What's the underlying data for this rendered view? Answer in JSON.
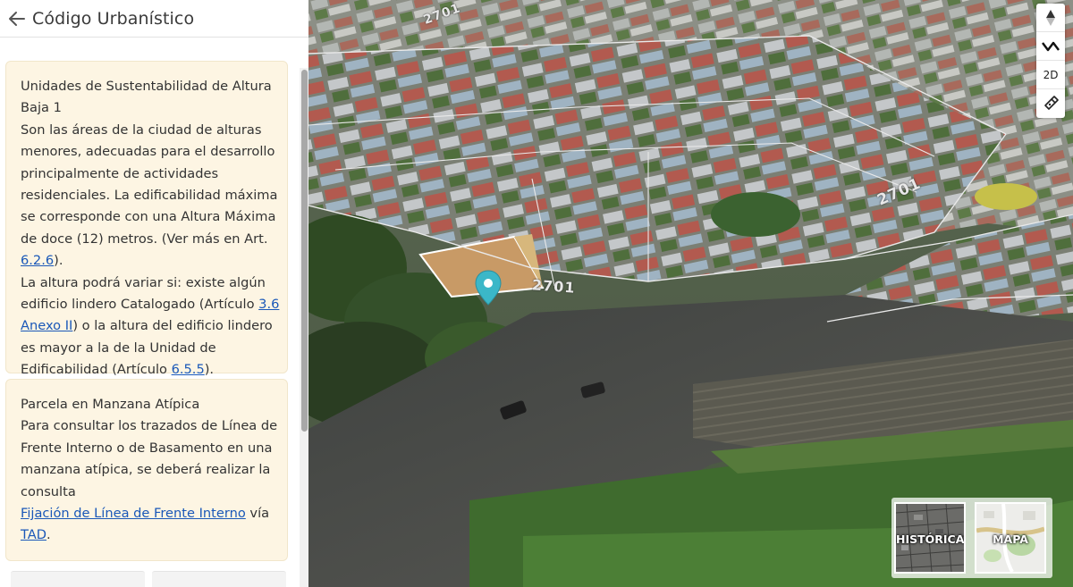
{
  "header": {
    "title": "Código Urbanístico",
    "back_icon": "arrow-left-icon"
  },
  "cards": [
    {
      "title": "Unidades de Sustentabilidad de Altura Baja 1",
      "text_1": "Son las áreas de la ciudad de alturas menores, adecuadas para el desarrollo principalmente de actividades residenciales. La edificabilidad máxima se corresponde con una Altura Máxima de doce (12) metros. (Ver más en Art. ",
      "link_1": "6.2.6",
      "text_2": ").",
      "text_3": "La altura podrá variar si: existe algún edificio lindero Catalogado (Artículo ",
      "link_2": "3.6 Anexo II",
      "text_4": ") o la altura del edificio lindero es mayor a la de la Unidad de Edificabilidad (Artículo ",
      "link_3": "6.5.5",
      "text_5": ")."
    },
    {
      "title": "Parcela en Manzana Atípica",
      "text_1": "Para consultar los trazados de Línea de Frente Interno o de Basamento en una manzana atípica, se deberá realizar la consulta",
      "link_1": "Fijación de Línea de Frente Interno",
      "text_2": " vía ",
      "link_2": "TAD",
      "text_3": "."
    }
  ],
  "map": {
    "street_labels": [
      "2701",
      "2701",
      "2701"
    ],
    "controls": {
      "compass_icon": "compass-reset-icon",
      "measure_icon": "route-measure-icon",
      "mode_label": "2D",
      "pegman_icon": "street-view-icon"
    },
    "layers": [
      {
        "label": "HISTÓRICA",
        "icon": "historic-aerial-thumbnail"
      },
      {
        "label": "MAPA",
        "icon": "street-map-thumbnail"
      }
    ]
  },
  "colors": {
    "card_background": "#fdf5e3",
    "link": "#1a58b8",
    "marker": "#3bb7c8"
  }
}
